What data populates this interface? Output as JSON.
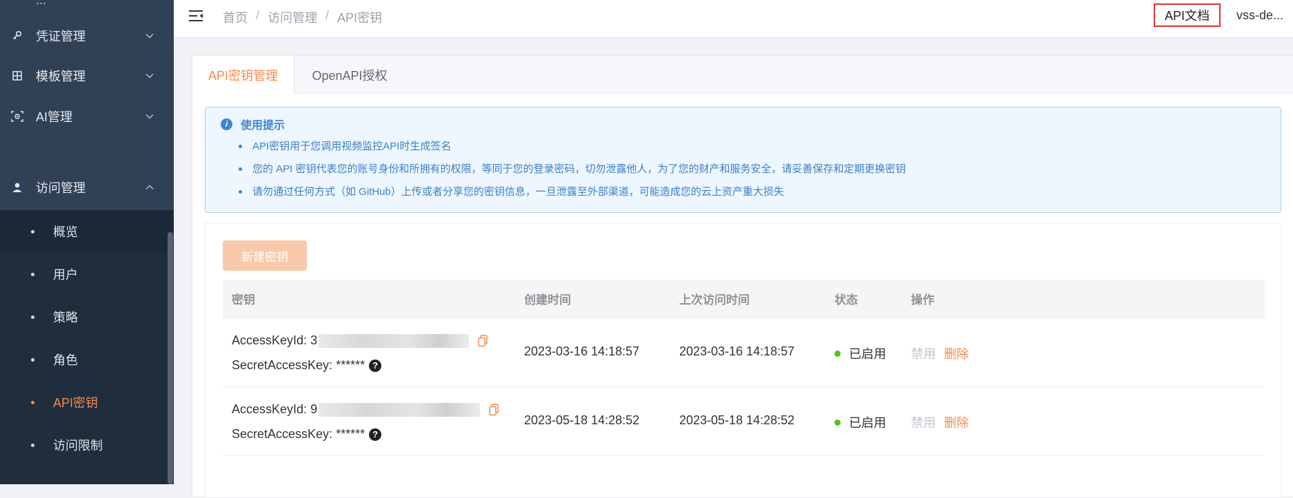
{
  "sidebar": {
    "top_fragment": "...",
    "menu": [
      {
        "label": "凭证管理",
        "icon": "key-icon"
      },
      {
        "label": "模板管理",
        "icon": "grid-icon"
      },
      {
        "label": "AI管理",
        "icon": "ai-scan-icon"
      },
      {
        "label": "访问管理",
        "icon": "user-icon"
      }
    ],
    "submenu": [
      {
        "label": "概览"
      },
      {
        "label": "用户"
      },
      {
        "label": "策略"
      },
      {
        "label": "角色"
      },
      {
        "label": "API密钥"
      },
      {
        "label": "访问限制"
      }
    ]
  },
  "header": {
    "breadcrumb": [
      "首页",
      "访问管理",
      "API密钥"
    ],
    "separator": "/",
    "api_doc": "API文档",
    "user": "vss-de..."
  },
  "tabs": [
    "API密钥管理",
    "OpenAPI授权"
  ],
  "tip": {
    "title": "使用提示",
    "items": [
      "API密钥用于您调用视频监控API时生成签名",
      "您的 API 密钥代表您的账号身份和所拥有的权限，等同于您的登录密码，切勿泄露他人，为了您的财产和服务安全，请妥善保存和定期更换密钥",
      "请勿通过任何方式（如 GitHub）上传或者分享您的密钥信息，一旦泄露至外部渠道，可能造成您的云上资产重大损失"
    ]
  },
  "new_key_button": "新建密钥",
  "table": {
    "columns": [
      "密钥",
      "创建时间",
      "上次访问时间",
      "状态",
      "操作"
    ],
    "rows": [
      {
        "access_key_label": "AccessKeyId:",
        "access_key_prefix": "3",
        "secret_label": "SecretAccessKey:",
        "secret_value": "******",
        "created": "2023-03-16 14:18:57",
        "last_access": "2023-03-16 14:18:57",
        "status": "已启用",
        "op_disable": "禁用",
        "op_delete": "删除"
      },
      {
        "access_key_label": "AccessKeyId:",
        "access_key_prefix": "9",
        "secret_label": "SecretAccessKey:",
        "secret_value": "******",
        "created": "2023-05-18 14:28:52",
        "last_access": "2023-05-18 14:28:52",
        "status": "已启用",
        "op_disable": "禁用",
        "op_delete": "删除"
      }
    ]
  },
  "colors": {
    "sidebar_bg": "#304156",
    "accent": "#f5894a",
    "tip_text": "#3d7fc6",
    "status_green": "#52c41a",
    "highlight_border": "#e03131"
  }
}
